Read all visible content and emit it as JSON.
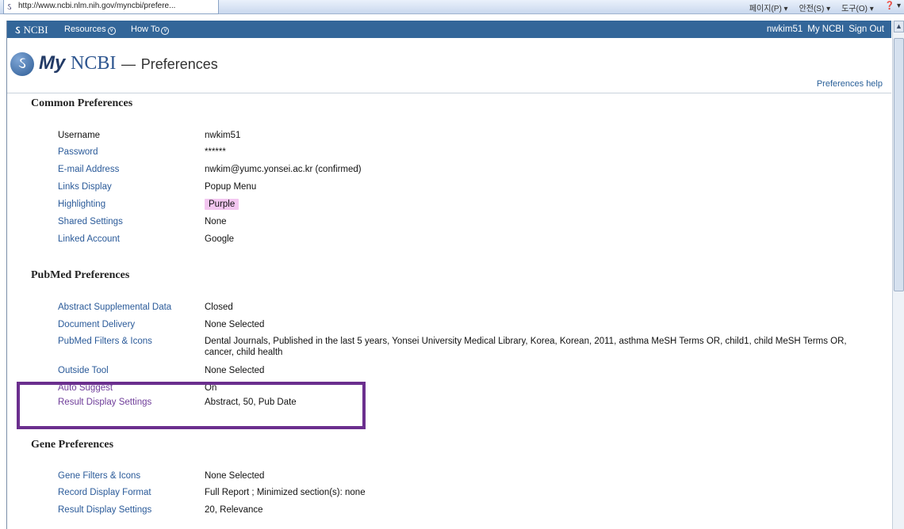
{
  "browser": {
    "tab_title": "http://www.ncbi.nlm.nih.gov/myncbi/prefere...",
    "commands": [
      "페이지(P) ▾",
      "안전(S) ▾",
      "도구(O) ▾",
      "❓ ▾"
    ]
  },
  "ncbi_bar": {
    "logo": "NCBI",
    "menu": [
      {
        "label": "Resources"
      },
      {
        "label": "How To"
      }
    ],
    "username": "nwkim51",
    "my_ncbi": "My NCBI",
    "sign_out": "Sign Out"
  },
  "header": {
    "logo_my": "My",
    "logo_ncbi": "NCBI",
    "dash": "—",
    "page_title": "Preferences",
    "help_link": "Preferences help"
  },
  "common": {
    "title": "Common Preferences",
    "rows": [
      {
        "label": "Username",
        "value": "nwkim51"
      },
      {
        "label": "Password",
        "value": "******"
      },
      {
        "label": "E-mail Address",
        "value": "nwkim@yumc.yonsei.ac.kr (confirmed)"
      },
      {
        "label": "Links Display",
        "value": "Popup Menu"
      },
      {
        "label": "Highlighting",
        "value": "Purple"
      },
      {
        "label": "Shared Settings",
        "value": "None"
      },
      {
        "label": "Linked Account",
        "value": "Google"
      }
    ]
  },
  "pubmed": {
    "title": "PubMed Preferences",
    "rows": [
      {
        "label": "Abstract Supplemental Data",
        "value": "Closed"
      },
      {
        "label": "Document Delivery",
        "value": "None Selected"
      },
      {
        "label": "PubMed Filters & Icons",
        "value": "Dental Journals, Published in the last 5 years, Yonsei University Medical Library, Korea, Korean, 2011, asthma MeSH Terms OR, child1, child MeSH Terms OR, cancer, child health"
      },
      {
        "label": "Outside Tool",
        "value": "None Selected"
      },
      {
        "label": "Auto Suggest",
        "value": "On"
      },
      {
        "label": "Result Display Settings",
        "value": "Abstract, 50, Pub Date"
      }
    ]
  },
  "gene": {
    "title": "Gene Preferences",
    "rows": [
      {
        "label": "Gene Filters & Icons",
        "value": "None Selected"
      },
      {
        "label": "Record Display Format",
        "value": "Full Report ; Minimized section(s): none"
      },
      {
        "label": "Result Display Settings",
        "value": "20, Relevance"
      }
    ]
  },
  "colors": {
    "ncbi_bar": "#336699",
    "link": "#2a5a99",
    "visited_link": "#6e3c99",
    "highlight": "#f3c6f0",
    "annotation_box": "#6b2f8e"
  }
}
